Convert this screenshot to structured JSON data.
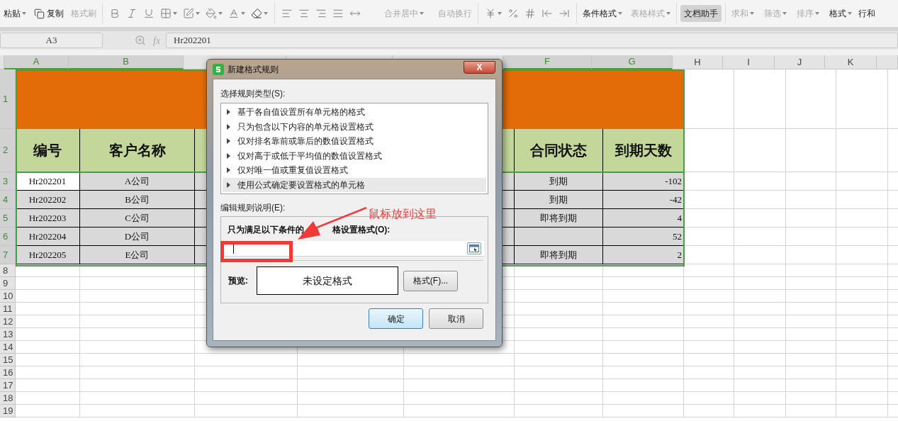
{
  "ribbon": {
    "paste": {
      "label": "粘贴",
      "disabled": false
    },
    "copy": {
      "label": "复制",
      "disabled": false
    },
    "format_painter": {
      "label": "格式刷",
      "disabled": true
    },
    "merge": {
      "label": "合并居中",
      "disabled": true
    },
    "wrap": {
      "label": "自动换行",
      "disabled": true
    },
    "conditional_format": {
      "label": "条件格式",
      "disabled": false
    },
    "table_style": {
      "label": "表格样式",
      "disabled": true
    },
    "assistant": {
      "label": "文档助手",
      "selected": true
    },
    "sum": {
      "label": "求和",
      "disabled": true
    },
    "filter": {
      "label": "筛选",
      "disabled": true
    },
    "sort": {
      "label": "排序",
      "disabled": true
    },
    "format": {
      "label": "格式",
      "disabled": false
    },
    "rows_cols": {
      "label": "行和"
    }
  },
  "formula_bar": {
    "name_box": "A3",
    "function_label": "fx",
    "value": "Hr202201"
  },
  "columns": [
    {
      "label": "A",
      "selected": true
    },
    {
      "label": "B",
      "selected": true
    },
    {
      "label": "F",
      "selected": true
    },
    {
      "label": "G",
      "selected": true
    },
    {
      "label": "H",
      "selected": false
    },
    {
      "label": "I",
      "selected": false
    },
    {
      "label": "J",
      "selected": false
    },
    {
      "label": "K",
      "selected": false
    }
  ],
  "rows": [
    {
      "label": "1",
      "selected": true,
      "kind": "title"
    },
    {
      "label": "2",
      "selected": true,
      "kind": "header",
      "cells": [
        "编号",
        "客户名称",
        "合同状态",
        "到期天数"
      ]
    },
    {
      "label": "3",
      "selected": true,
      "kind": "data",
      "cells": [
        {
          "text": "Hr202201",
          "active": true
        },
        {
          "text": "A公司",
          "active": false
        },
        {
          "text": "到期",
          "active": false
        },
        {
          "text": "-102",
          "active": false
        }
      ]
    },
    {
      "label": "4",
      "selected": true,
      "kind": "data",
      "cells": [
        {
          "text": "Hr202202",
          "active": false
        },
        {
          "text": "B公司",
          "active": false
        },
        {
          "text": "到期",
          "active": false
        },
        {
          "text": "-42",
          "active": false
        }
      ]
    },
    {
      "label": "5",
      "selected": true,
      "kind": "data",
      "cells": [
        {
          "text": "Hr202203",
          "active": false
        },
        {
          "text": "C公司",
          "active": false
        },
        {
          "text": "即将到期",
          "active": false
        },
        {
          "text": "4",
          "active": false
        }
      ]
    },
    {
      "label": "6",
      "selected": true,
      "kind": "data",
      "cells": [
        {
          "text": "Hr202204",
          "active": false
        },
        {
          "text": "D公司",
          "active": false
        },
        {
          "active": false
        },
        {
          "text": "52",
          "active": false
        }
      ]
    },
    {
      "label": "7",
      "selected": true,
      "kind": "data",
      "cells": [
        {
          "text": "Hr202205",
          "active": false
        },
        {
          "text": "E公司",
          "active": false
        },
        {
          "text": "即将到期",
          "active": false
        },
        {
          "text": "2",
          "active": false
        }
      ]
    },
    {
      "label": "8",
      "selected": false,
      "kind": "empty"
    },
    {
      "label": "9",
      "selected": false,
      "kind": "empty"
    },
    {
      "label": "10",
      "selected": false,
      "kind": "empty"
    },
    {
      "label": "11",
      "selected": false,
      "kind": "empty"
    },
    {
      "label": "12",
      "selected": false,
      "kind": "empty"
    },
    {
      "label": "13",
      "selected": false,
      "kind": "empty"
    },
    {
      "label": "14",
      "selected": false,
      "kind": "empty"
    },
    {
      "label": "15",
      "selected": false,
      "kind": "empty"
    },
    {
      "label": "16",
      "selected": false,
      "kind": "empty"
    },
    {
      "label": "17",
      "selected": false,
      "kind": "empty"
    },
    {
      "label": "18",
      "selected": false,
      "kind": "empty"
    },
    {
      "label": "19",
      "selected": false,
      "kind": "empty"
    }
  ],
  "dialog": {
    "title": "新建格式规则",
    "close": "X",
    "rule_type_label": "选择规则类型(S):",
    "rule_types": [
      {
        "label": "基于各自值设置所有单元格的格式",
        "selected": false
      },
      {
        "label": "只为包含以下内容的单元格设置格式",
        "selected": false
      },
      {
        "label": "仅对排名靠前或靠后的数值设置格式",
        "selected": false
      },
      {
        "label": "仅对高于或低于平均值的数值设置格式",
        "selected": false
      },
      {
        "label": "仅对唯一值或重复值设置格式",
        "selected": false
      },
      {
        "label": "使用公式确定要设置格式的单元格",
        "selected": true
      }
    ],
    "description_label": "编辑规则说明(E):",
    "condition_label_start": "只为满足以下条件的",
    "condition_label_end": "格设置格式(O):",
    "preview_label": "预览:",
    "preview_text": "未设定格式",
    "format_button": "格式(F)...",
    "ok_button": "确定",
    "cancel_button": "取消"
  },
  "annotation": {
    "text": "鼠标放到这里"
  }
}
